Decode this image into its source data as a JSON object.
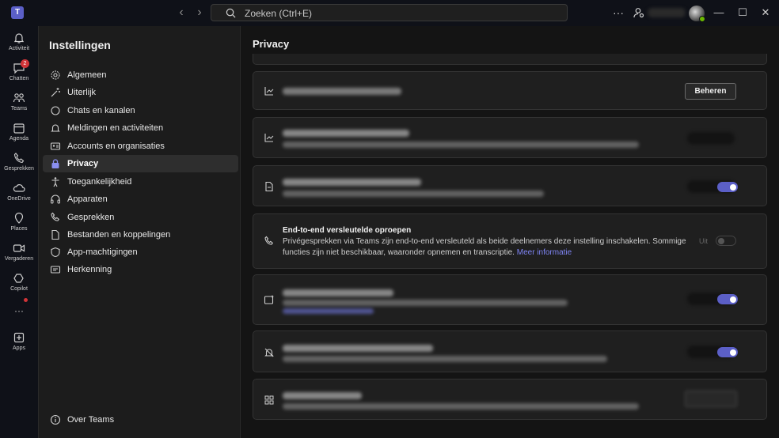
{
  "titlebar": {
    "app_logo_text": "T",
    "search_placeholder": "Zoeken (Ctrl+E)",
    "more_label": "···"
  },
  "rail": {
    "items": [
      {
        "label": "Activiteit",
        "icon": "bell-icon"
      },
      {
        "label": "Chatten",
        "icon": "chat-icon",
        "badge": "2"
      },
      {
        "label": "Teams",
        "icon": "teams-icon"
      },
      {
        "label": "Agenda",
        "icon": "calendar-icon"
      },
      {
        "label": "Gesprekken",
        "icon": "phone-icon"
      },
      {
        "label": "OneDrive",
        "icon": "cloud-icon"
      },
      {
        "label": "Places",
        "icon": "places-icon"
      },
      {
        "label": "Vergaderen",
        "icon": "video-icon"
      },
      {
        "label": "Copilot",
        "icon": "copilot-icon"
      },
      {
        "label": "···",
        "icon": "more-icon"
      },
      {
        "label": "Apps",
        "icon": "apps-icon"
      }
    ]
  },
  "sidebar": {
    "title": "Instellingen",
    "items": [
      {
        "label": "Algemeen",
        "icon": "gear-icon"
      },
      {
        "label": "Uiterlijk",
        "icon": "wand-icon"
      },
      {
        "label": "Chats en kanalen",
        "icon": "chat-icon"
      },
      {
        "label": "Meldingen en activiteiten",
        "icon": "bell-icon"
      },
      {
        "label": "Accounts en organisaties",
        "icon": "id-card-icon"
      },
      {
        "label": "Privacy",
        "icon": "lock-icon",
        "active": true
      },
      {
        "label": "Toegankelijkheid",
        "icon": "accessibility-icon"
      },
      {
        "label": "Apparaten",
        "icon": "headset-icon"
      },
      {
        "label": "Gesprekken",
        "icon": "phone-icon"
      },
      {
        "label": "Bestanden en koppelingen",
        "icon": "file-icon"
      },
      {
        "label": "App-machtigingen",
        "icon": "shield-icon"
      },
      {
        "label": "Herkenning",
        "icon": "recognition-icon"
      }
    ],
    "footer_label": "Over Teams"
  },
  "main": {
    "title": "Privacy",
    "manage_button": "Beheren",
    "cards": [
      {
        "title": "End-to-end versleutelde oproepen",
        "desc": "Privégesprekken via Teams zijn end-to-end versleuteld als beide deelnemers deze instelling inschakelen. Sommige functies zijn niet beschikbaar, waaronder opnemen en transcriptie.",
        "link": "Meer informatie",
        "toggle_label": "Uit"
      }
    ]
  }
}
